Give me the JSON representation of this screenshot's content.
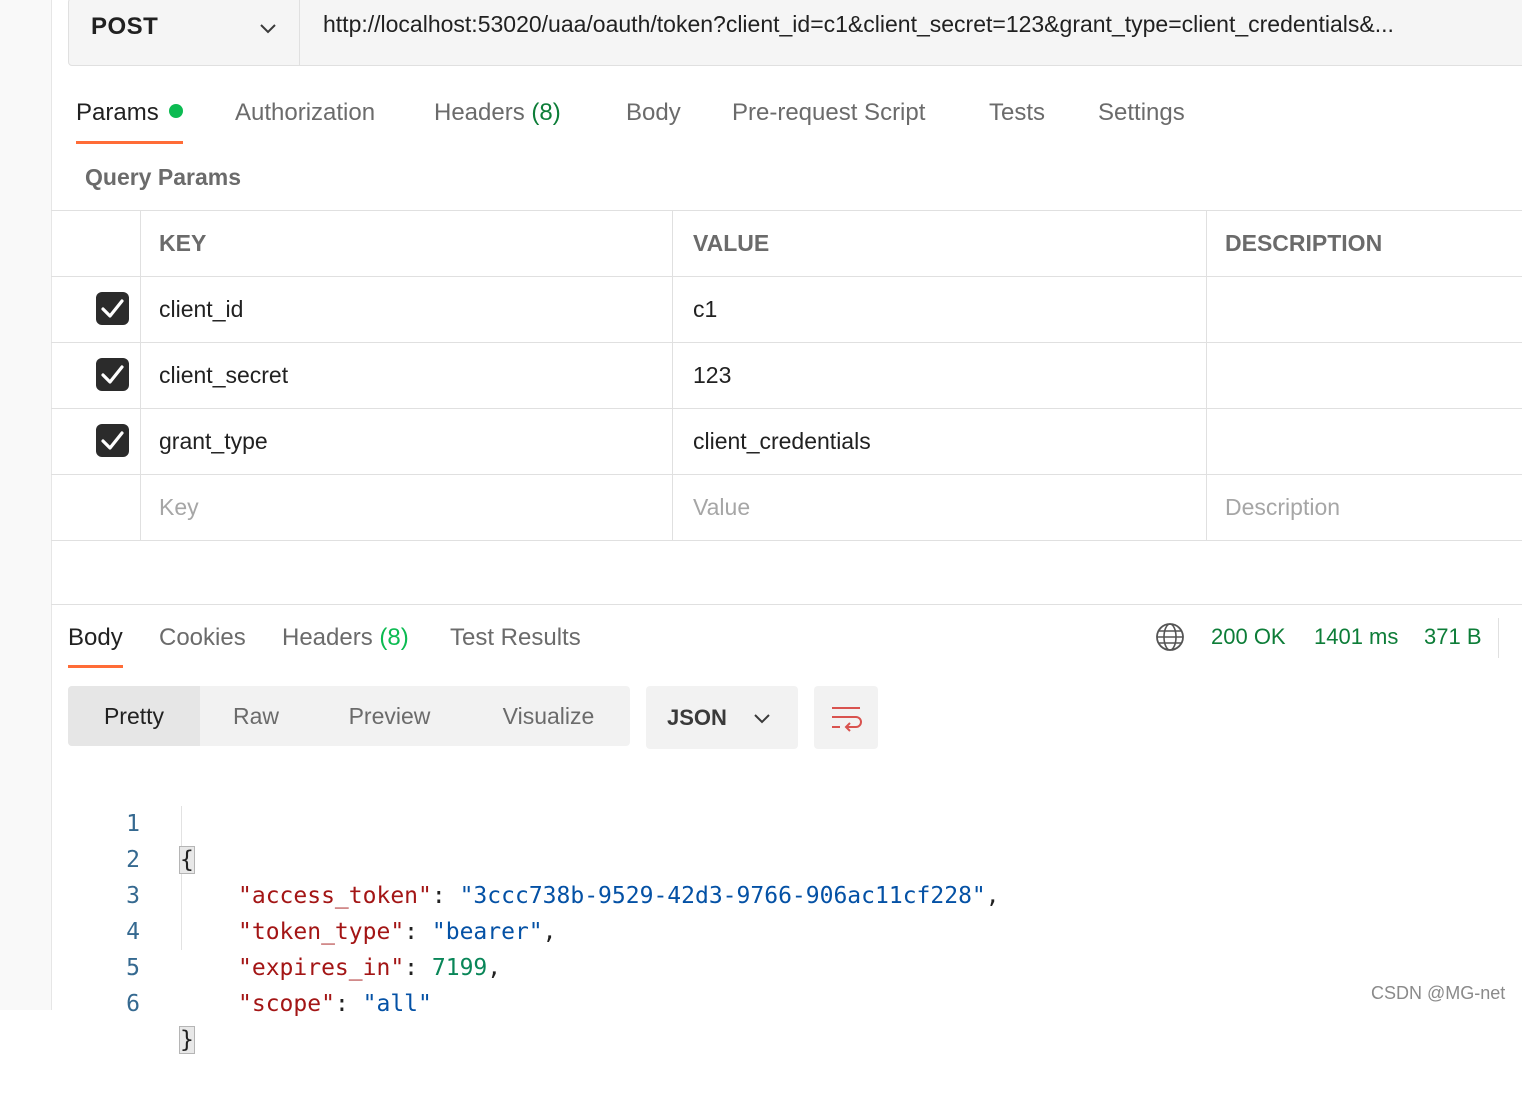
{
  "request": {
    "method": "POST",
    "url": "http://localhost:53020/uaa/oauth/token?client_id=c1&client_secret=123&grant_type=client_credentials&..."
  },
  "req_tabs": {
    "params": "Params",
    "authorization": "Authorization",
    "headers": "Headers",
    "headers_count": "(8)",
    "body": "Body",
    "pre_request": "Pre-request Script",
    "tests": "Tests",
    "settings": "Settings"
  },
  "query_params": {
    "title": "Query Params",
    "columns": [
      "KEY",
      "VALUE",
      "DESCRIPTION"
    ],
    "rows": [
      {
        "key": "client_id",
        "value": "c1",
        "description": ""
      },
      {
        "key": "client_secret",
        "value": "123",
        "description": ""
      },
      {
        "key": "grant_type",
        "value": "client_credentials",
        "description": ""
      }
    ],
    "placeholders": {
      "key": "Key",
      "value": "Value",
      "description": "Description"
    }
  },
  "resp_tabs": {
    "body": "Body",
    "cookies": "Cookies",
    "headers": "Headers",
    "headers_count": "(8)",
    "test_results": "Test Results"
  },
  "response_meta": {
    "status": "200 OK",
    "time": "1401 ms",
    "size": "371 B"
  },
  "view_modes": {
    "pretty": "Pretty",
    "raw": "Raw",
    "preview": "Preview",
    "visualize": "Visualize",
    "format": "JSON"
  },
  "code": {
    "line_numbers": [
      "1",
      "2",
      "3",
      "4",
      "5",
      "6"
    ],
    "open_brace": "{",
    "close_brace": "}",
    "k1": "\"access_token\"",
    "v1": "\"3ccc738b-9529-42d3-9766-906ac11cf228\"",
    "k2": "\"token_type\"",
    "v2": "\"bearer\"",
    "k3": "\"expires_in\"",
    "v3": "7199",
    "k4": "\"scope\"",
    "v4": "\"all\""
  },
  "watermark": "CSDN @MG-net",
  "colors": {
    "accent": "#ff6c37",
    "status_green": "#0d7d38",
    "dot_green": "#0cbb52"
  }
}
